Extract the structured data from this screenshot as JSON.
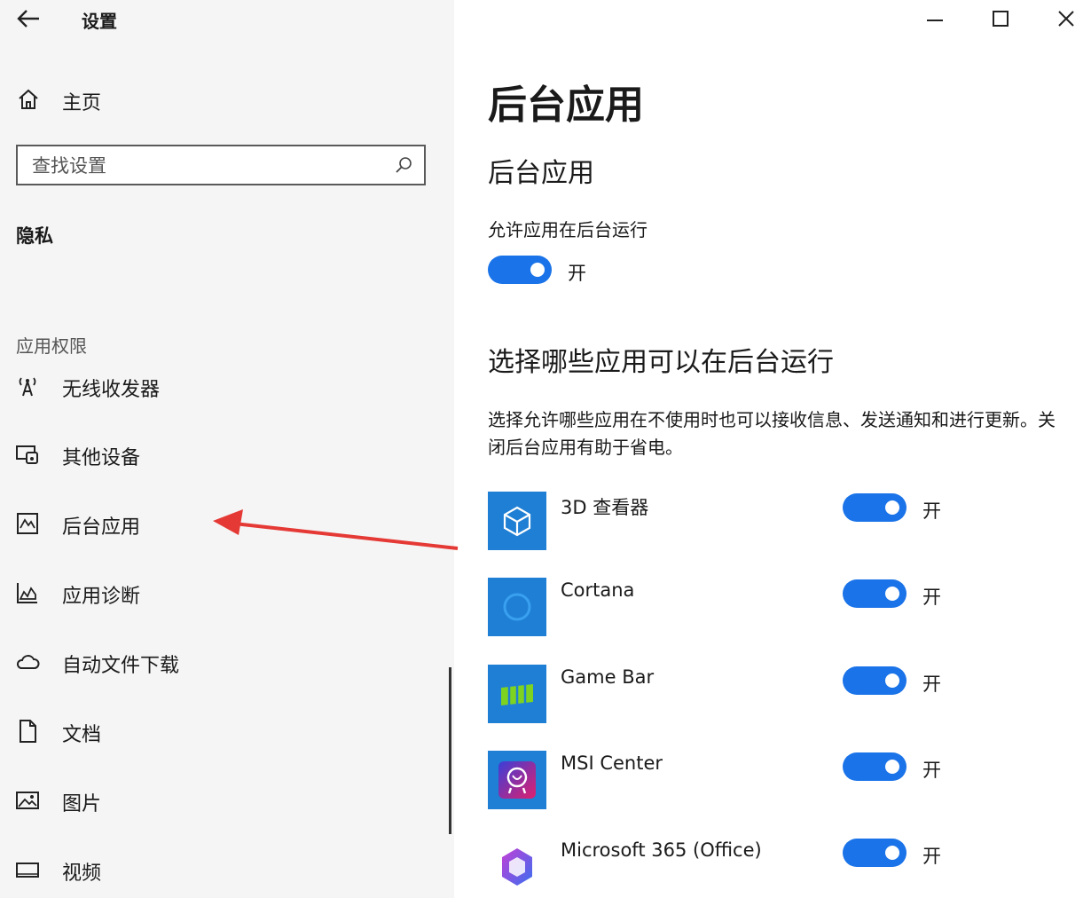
{
  "window": {
    "title": "设置",
    "controls": {
      "minimize_glyph": "—",
      "maximize_glyph": "☐",
      "close_glyph": "✕"
    }
  },
  "sidebar": {
    "home_label": "主页",
    "search": {
      "placeholder": "查找设置",
      "value": ""
    },
    "section_title": "隐私",
    "group_label": "应用权限",
    "items": [
      {
        "label": "无线收发器",
        "icon": "radio-antenna-icon"
      },
      {
        "label": "其他设备",
        "icon": "devices-icon"
      },
      {
        "label": "后台应用",
        "icon": "background-apps-icon"
      },
      {
        "label": "应用诊断",
        "icon": "diagnostics-icon"
      },
      {
        "label": "自动文件下载",
        "icon": "cloud-icon"
      },
      {
        "label": "文档",
        "icon": "document-icon"
      },
      {
        "label": "图片",
        "icon": "picture-icon"
      },
      {
        "label": "视频",
        "icon": "video-icon"
      }
    ]
  },
  "main": {
    "page_title": "后台应用",
    "section_heading": "后台应用",
    "allow_label": "允许应用在后台运行",
    "allow_toggle": {
      "on": true,
      "state_text": "开"
    },
    "choose_heading": "选择哪些应用可以在后台运行",
    "description": "选择允许哪些应用在不使用时也可以接收信息、发送通知和进行更新。关闭后台应用有助于省电。",
    "apps": [
      {
        "name": "3D 查看器",
        "on": true,
        "state_text": "开",
        "icon": "cube-icon",
        "tile_color": "#1f7fd4"
      },
      {
        "name": "Cortana",
        "on": true,
        "state_text": "开",
        "icon": "cortana-ring-icon",
        "tile_color": "#1f7fd4"
      },
      {
        "name": "Game Bar",
        "on": true,
        "state_text": "开",
        "icon": "game-bar-icon",
        "tile_color": "#1f7fd4"
      },
      {
        "name": "MSI Center",
        "on": true,
        "state_text": "开",
        "icon": "msi-center-icon",
        "tile_color": "#1f7fd4"
      },
      {
        "name": "Microsoft 365 (Office)",
        "on": true,
        "state_text": "开",
        "icon": "microsoft-365-icon",
        "tile_color": ""
      }
    ]
  },
  "colors": {
    "accent": "#1a73e8",
    "sidebar_bg": "#f5f5f5",
    "annotation_arrow": "#e53935"
  }
}
